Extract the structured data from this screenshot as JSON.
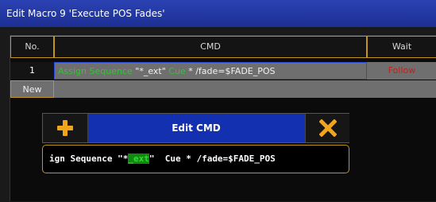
{
  "window": {
    "title": "Edit Macro 9 'Execute POS Fades'"
  },
  "table": {
    "headers": {
      "no": "No.",
      "cmd": "CMD",
      "wait": "Wait"
    },
    "rows": [
      {
        "no": "1",
        "cmd": {
          "part1": "Assign Sequence",
          "part2": " \"*_ext\" ",
          "part3": "Cue",
          "part4": " * /fade=$FADE_POS"
        },
        "wait": "Follow"
      }
    ],
    "new_label": "New"
  },
  "dialog": {
    "title": "Edit CMD",
    "add_icon": "plus-icon",
    "close_icon": "close-x-icon",
    "input": {
      "before": "ign Sequence \"*",
      "selected": "_ext",
      "after": "\"  Cue * /fade=$FADE_POS"
    }
  },
  "colors": {
    "title_bar": "#2233a6",
    "accent_gold": "#c3951f",
    "keyword_green": "#34c234",
    "wait_red": "#c0211b",
    "cell_grey": "#6f6f6f",
    "dialog_blue": "#1230b0",
    "add_icon": "#f0a51d",
    "close_icon": "#f0a51d"
  }
}
